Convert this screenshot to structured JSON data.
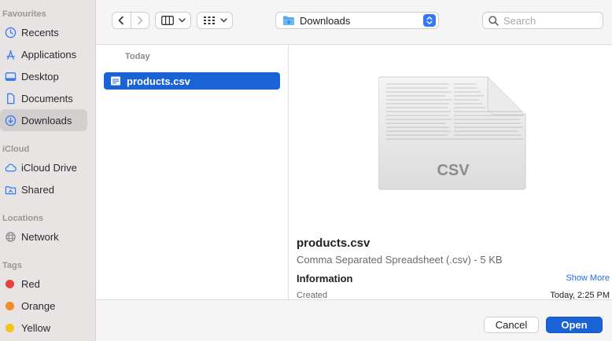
{
  "sidebar": {
    "favourites_heading": "Favourites",
    "items": [
      {
        "label": "Recents",
        "icon": "clock-icon"
      },
      {
        "label": "Applications",
        "icon": "applications-icon"
      },
      {
        "label": "Desktop",
        "icon": "desktop-icon"
      },
      {
        "label": "Documents",
        "icon": "document-icon"
      },
      {
        "label": "Downloads",
        "icon": "download-icon",
        "selected": true
      }
    ],
    "icloud_heading": "iCloud",
    "icloud_items": [
      {
        "label": "iCloud Drive",
        "icon": "cloud-icon"
      },
      {
        "label": "Shared",
        "icon": "shared-folder-icon"
      }
    ],
    "locations_heading": "Locations",
    "locations_items": [
      {
        "label": "Network",
        "icon": "globe-icon"
      }
    ],
    "tags_heading": "Tags",
    "tags": [
      {
        "label": "Red",
        "color": "#e9423a"
      },
      {
        "label": "Orange",
        "color": "#f08d2a"
      },
      {
        "label": "Yellow",
        "color": "#f3c21c"
      }
    ]
  },
  "toolbar": {
    "location_label": "Downloads",
    "search_placeholder": "Search"
  },
  "filelist": {
    "section_header": "Today",
    "selected_file": "products.csv"
  },
  "preview": {
    "badge": "CSV",
    "file_name": "products.csv",
    "file_type": "Comma Separated Spreadsheet (.csv) - 5 KB",
    "information_heading": "Information",
    "show_more": "Show More",
    "created_label": "Created",
    "created_value": "Today, 2:25 PM"
  },
  "buttons": {
    "cancel": "Cancel",
    "open": "Open"
  },
  "colors": {
    "accent": "#1a63d6",
    "sidebar_icon": "#3478f6"
  }
}
